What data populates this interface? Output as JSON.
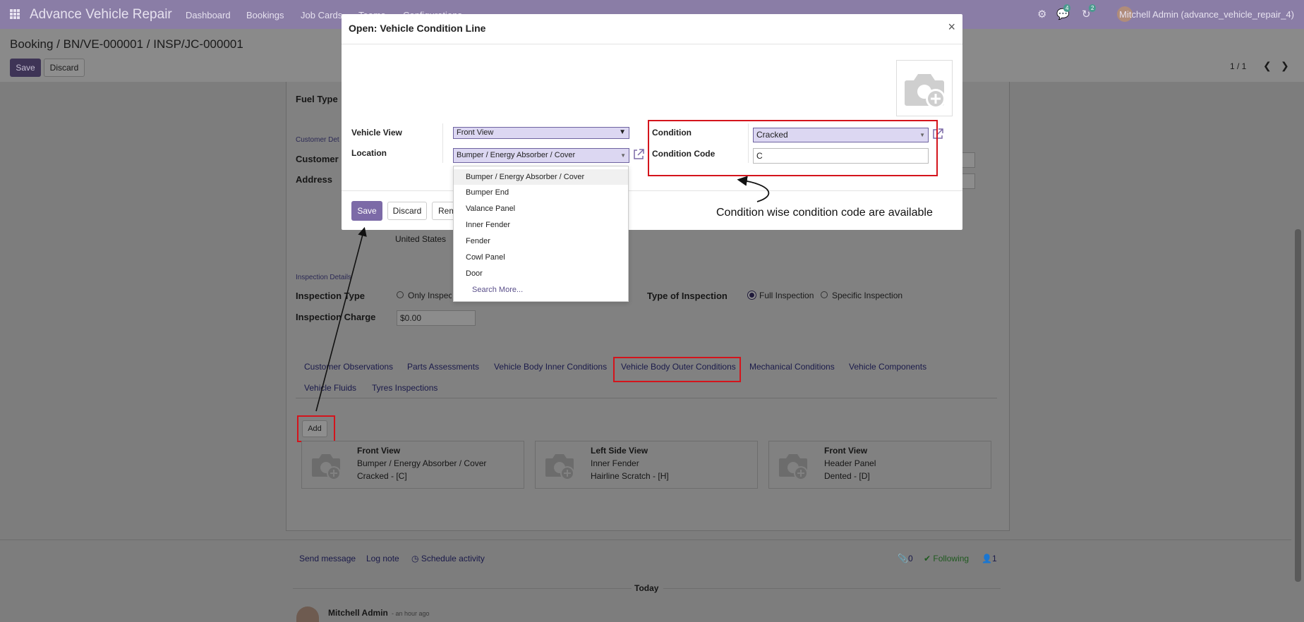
{
  "navbar": {
    "app_name": "Advance Vehicle Repair",
    "menu": [
      "Dashboard",
      "Bookings",
      "Job Cards",
      "Teams",
      "Configurations"
    ],
    "chat_badge": "4",
    "activity_badge": "2",
    "user": "Mitchell Admin (advance_vehicle_repair_4)"
  },
  "control_panel": {
    "breadcrumb": [
      "Booking",
      "BN/VE-000001",
      "INSP/JC-000001"
    ],
    "separator": "/",
    "save_label": "Save",
    "discard_label": "Discard",
    "pager": "1 / 1"
  },
  "form": {
    "fuel_type_label": "Fuel Type",
    "customer_section": "Customer Det",
    "customer_label": "Customer",
    "address_label": "Address",
    "country_value": "United States",
    "inspection_section": "Inspection Details",
    "inspection_type_label": "Inspection Type",
    "inspection_type_option": "Only Inspec",
    "inspection_charge_label": "Inspection Charge",
    "inspection_charge_value": "$0.00",
    "type_of_inspection_label": "Type of Inspection",
    "full_inspection": "Full Inspection",
    "specific_inspection": "Specific Inspection"
  },
  "tabs": [
    "Customer Observations",
    "Parts Assessments",
    "Vehicle Body Inner Conditions",
    "Vehicle Body Outer Conditions",
    "Mechanical Conditions",
    "Vehicle Components",
    "Vehicle Fluids",
    "Tyres Inspections"
  ],
  "active_tab": "Vehicle Body Outer Conditions",
  "add_label": "Add",
  "cards": [
    {
      "view": "Front View",
      "location": "Bumper / Energy Absorber / Cover",
      "condition": "Cracked - [C]"
    },
    {
      "view": "Left Side View",
      "location": "Inner Fender",
      "condition": "Hairline Scratch - [H]"
    },
    {
      "view": "Front View",
      "location": "Header Panel",
      "condition": "Dented - [D]"
    }
  ],
  "chatter": {
    "send_message": "Send message",
    "log_note": "Log note",
    "schedule_activity": "Schedule activity",
    "attachments": "0",
    "following": "Following",
    "followers": "1",
    "today": "Today",
    "author": "Mitchell Admin",
    "time": "- an hour ago"
  },
  "modal": {
    "title": "Open: Vehicle Condition Line",
    "close": "×",
    "vehicle_view_label": "Vehicle View",
    "vehicle_view_value": "Front View",
    "location_label": "Location",
    "location_value": "Bumper / Energy Absorber / Cover",
    "condition_label": "Condition",
    "condition_value": "Cracked",
    "condition_code_label": "Condition Code",
    "condition_code_value": "C",
    "save_label": "Save",
    "discard_label": "Discard",
    "remove_label": "Remove"
  },
  "dropdown": {
    "items": [
      "Bumper / Energy Absorber / Cover",
      "Bumper End",
      "Valance Panel",
      "Inner Fender",
      "Fender",
      "Cowl Panel",
      "Door"
    ],
    "search_more": "Search More..."
  },
  "annotation": "Condition wise condition code are available",
  "colors": {
    "brand": "#7c6aa7",
    "highlight": "#d4141c",
    "select_bg": "#dcd7f2"
  }
}
